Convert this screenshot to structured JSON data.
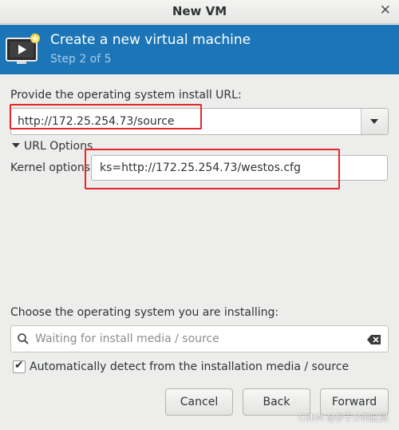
{
  "window": {
    "title": "New VM"
  },
  "banner": {
    "heading": "Create a new virtual machine",
    "step": "Step 2 of 5"
  },
  "install_url": {
    "label": "Provide the operating system install URL:",
    "value": "http://172.25.254.73/source"
  },
  "url_options": {
    "expander_label": "URL Options",
    "kernel_label": "Kernel options",
    "kernel_value": "ks=http://172.25.254.73/westos.cfg"
  },
  "os_select": {
    "label": "Choose the operating system you are installing:",
    "placeholder": "Waiting for install media / source",
    "auto_detect_label": "Automatically detect from the installation media / source",
    "auto_detect_checked": true
  },
  "buttons": {
    "cancel": "Cancel",
    "back": "Back",
    "forward": "Forward"
  },
  "watermark": "CSDN @多于少的区别",
  "colors": {
    "banner": "#1b75b6",
    "annotation": "#e5262a"
  }
}
